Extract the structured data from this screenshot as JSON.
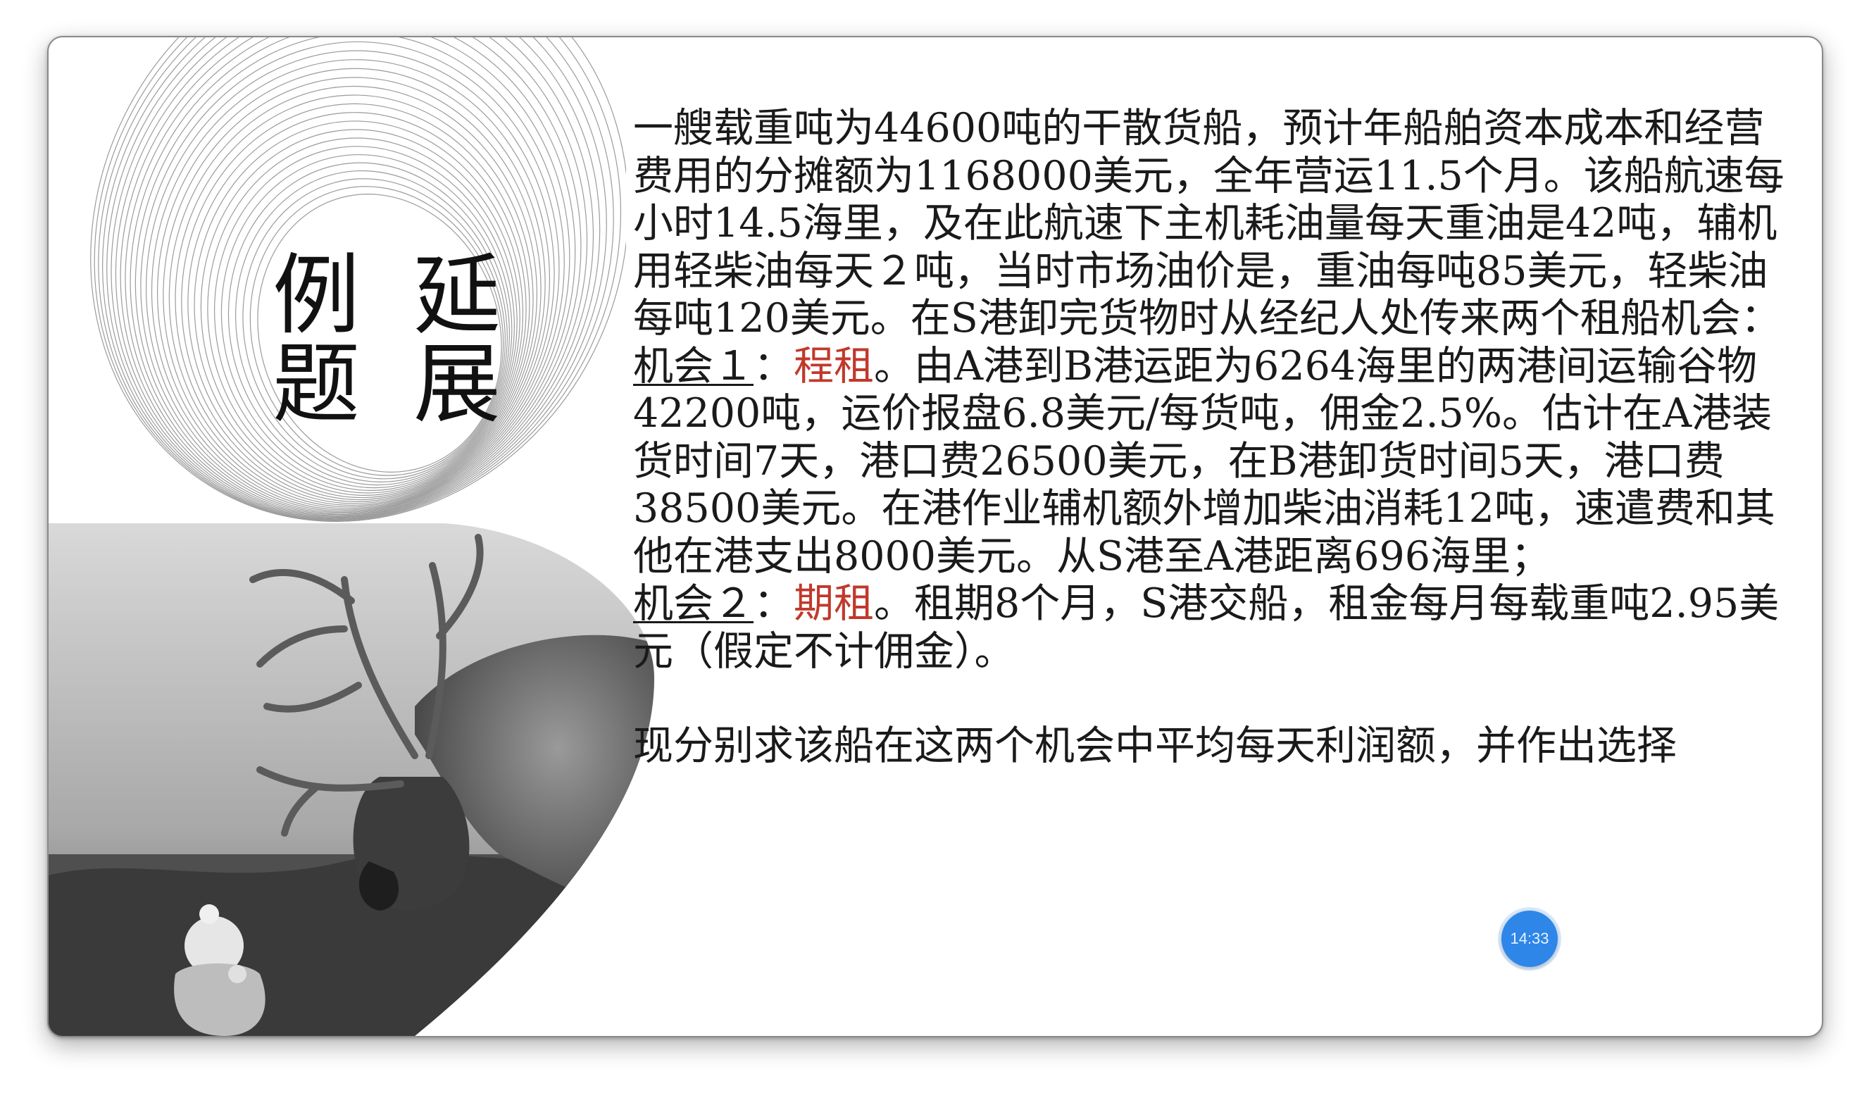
{
  "slide": {
    "title_col1": "延展",
    "title_col2": "例题",
    "paragraph_intro": "一艘载重吨为44600吨的干散货船，预计年船舶资本成本和经营费用的分摊额为1168000美元，全年营运11.5个月。该船航速每小时14.5海里，及在此航速下主机耗油量每天重油是42吨，辅机用轻柴油每天２吨，当时市场油价是，重油每吨85美元，轻柴油每吨120美元。在S港卸完货物时从经纪人处传来两个租船机会：",
    "opp1_label": "机会１",
    "opp1_sep": "：",
    "opp1_type": "程租",
    "opp1_text": "。由A港到B港运距为6264海里的两港间运输谷物42200吨，运价报盘6.8美元/每货吨，佣金2.5%。估计在A港装货时间7天，港口费26500美元，在B港卸货时间5天，港口费38500美元。在港作业辅机额外增加柴油消耗12吨，速遣费和其他在港支出8000美元。从S港至A港距离696海里；",
    "opp2_label": "机会２",
    "opp2_sep": "：",
    "opp2_type": "期租",
    "opp2_text": "。租期8个月，S港交船，租金每月每载重吨2.95美元（假定不计佣金）。",
    "question": "现分别求该船在这两个机会中平均每天利润额，并作出选择"
  },
  "timer": {
    "label": "14:33"
  },
  "colors": {
    "accent_red": "#c0392b",
    "timer_blue": "#2e86e8"
  }
}
